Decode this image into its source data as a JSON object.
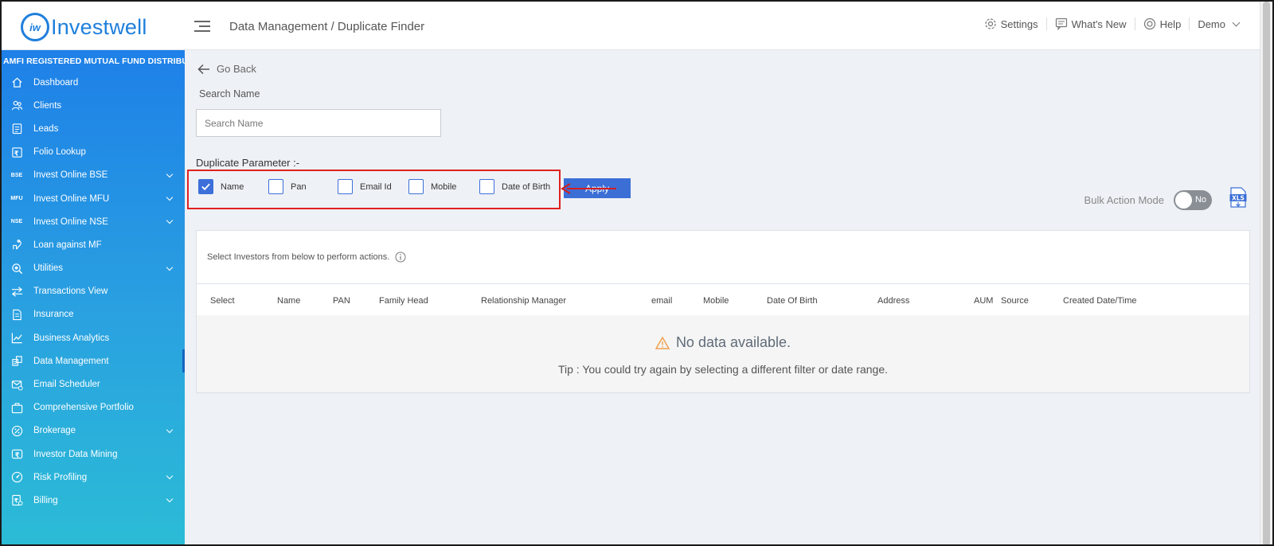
{
  "header": {
    "logo_mark": "iw",
    "logo_text": "Investwell",
    "breadcrumb": "Data Management / Duplicate Finder",
    "settings": "Settings",
    "whats_new": "What's New",
    "help": "Help",
    "user": "Demo"
  },
  "sidebar": {
    "title": "AMFI REGISTERED MUTUAL FUND DISTRIBUTOR",
    "items": [
      {
        "label": "Dashboard",
        "icon": "home-icon"
      },
      {
        "label": "Clients",
        "icon": "users-icon"
      },
      {
        "label": "Leads",
        "icon": "clipboard-icon"
      },
      {
        "label": "Folio Lookup",
        "icon": "folio-icon"
      },
      {
        "label": "Invest Online BSE",
        "icon": "BSE",
        "expandable": true
      },
      {
        "label": "Invest Online MFU",
        "icon": "MFU",
        "expandable": true
      },
      {
        "label": "Invest Online NSE",
        "icon": "NSE",
        "expandable": true
      },
      {
        "label": "Loan against MF",
        "icon": "loan-icon"
      },
      {
        "label": "Utilities",
        "icon": "utilities-icon",
        "expandable": true
      },
      {
        "label": "Transactions View",
        "icon": "transfer-icon"
      },
      {
        "label": "Insurance",
        "icon": "document-icon"
      },
      {
        "label": "Business Analytics",
        "icon": "chart-icon"
      },
      {
        "label": "Data Management",
        "icon": "database-icon",
        "active": true
      },
      {
        "label": "Email Scheduler",
        "icon": "mail-icon"
      },
      {
        "label": "Comprehensive Portfolio",
        "icon": "briefcase-icon"
      },
      {
        "label": "Brokerage",
        "icon": "percent-icon",
        "expandable": true
      },
      {
        "label": "Investor Data Mining",
        "icon": "rupee-icon"
      },
      {
        "label": "Risk Profiling",
        "icon": "gauge-icon",
        "expandable": true
      },
      {
        "label": "Billing",
        "icon": "bill-icon",
        "expandable": true
      }
    ]
  },
  "main": {
    "go_back": "Go Back",
    "search_label": "Search Name",
    "search_placeholder": "Search Name",
    "search_value": "",
    "duplicate_label": "Duplicate Parameter :-",
    "params": [
      {
        "label": "Name",
        "checked": true
      },
      {
        "label": "Pan",
        "checked": false
      },
      {
        "label": "Email Id",
        "checked": false
      },
      {
        "label": "Mobile",
        "checked": false
      },
      {
        "label": "Date of Birth",
        "checked": false
      }
    ],
    "apply": "Apply",
    "bulk_label": "Bulk Action Mode",
    "bulk_toggle": "No",
    "hint": "Select Investors from below to perform actions.",
    "columns": [
      "Select",
      "Name",
      "PAN",
      "Family Head",
      "Relationship Manager",
      "email",
      "Mobile",
      "Date Of Birth",
      "Address",
      "AUM",
      "Source",
      "Created Date/Time"
    ],
    "no_data": "No data available.",
    "tip": "Tip : You could try again by selecting a different filter or date range."
  },
  "colors": {
    "brand": "#1f7fdc",
    "accent": "#3b6fd6",
    "highlight": "#e02020",
    "warning": "#f0a050"
  }
}
